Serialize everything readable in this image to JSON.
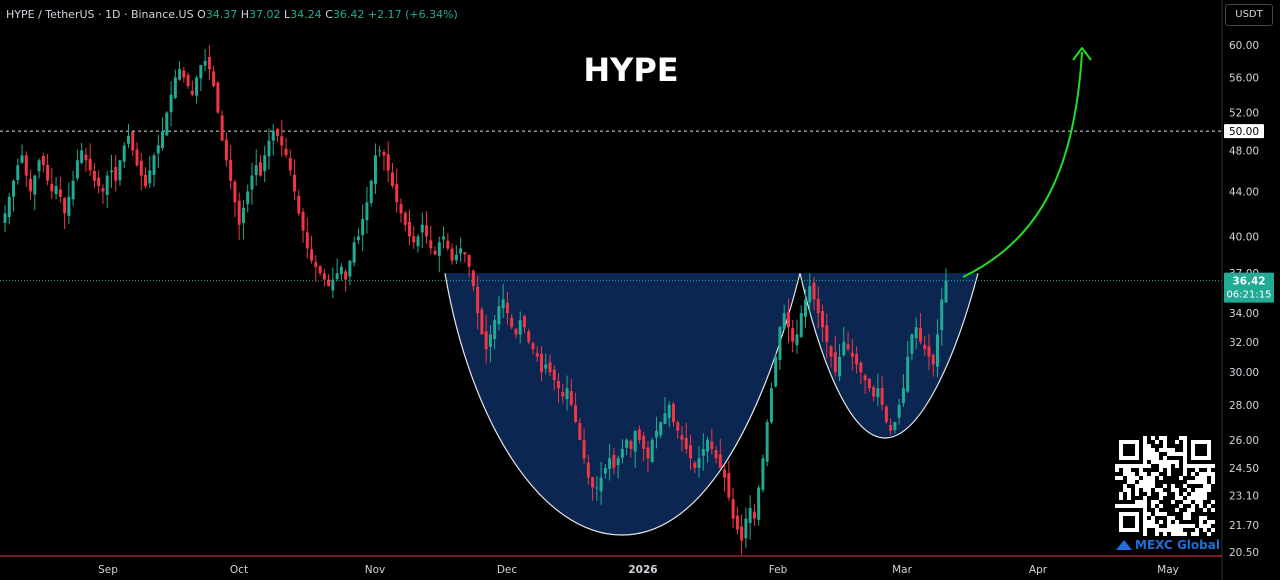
{
  "header": {
    "symbol_line": "HYPE / TetherUS · 1D · Binance.US",
    "o_label": "O",
    "o_value": "34.37",
    "h_label": "H",
    "h_value": "37.02",
    "l_label": "L",
    "l_value": "34.24",
    "c_label": "C",
    "c_value": "36.42",
    "change": "+2.17 (+6.34%)"
  },
  "currency_button": "USDT",
  "watermark_brand": "MEXC Global",
  "colors": {
    "background": "#000000",
    "up": "#22ab94",
    "down": "#f23645",
    "pattern_fill": "#0c2a5a",
    "arrow": "#22dd22",
    "axis_text": "#d1d4dc",
    "price_tag": "#22ab94"
  },
  "chart_data": {
    "type": "candlestick",
    "title": "HYPE",
    "y_ticks": [
      20.5,
      21.7,
      23.1,
      24.5,
      26.0,
      28.0,
      30.0,
      32.0,
      34.0,
      37.0,
      40.0,
      44.0,
      48.0,
      52.0,
      56.0,
      60.0
    ],
    "y_tick_labels": [
      "20.50",
      "21.70",
      "23.10",
      "24.50",
      "26.00",
      "28.00",
      "30.00",
      "32.00",
      "34.00",
      "37.00",
      "40.00",
      "44.00",
      "48.00",
      "52.00",
      "56.00",
      "60.00"
    ],
    "y_scale": "log",
    "ylim": [
      20.2,
      64
    ],
    "x_ticks": [
      "Sep",
      "Oct",
      "Nov",
      "Dec",
      "2026",
      "Feb",
      "Mar",
      "Apr",
      "May"
    ],
    "x_ticks_bold": "2026",
    "reference_line": {
      "value": 50.0,
      "label": "50.00",
      "style": "dashed"
    },
    "last_price": {
      "value": 36.42,
      "label": "36.42",
      "countdown": "06:21:15"
    },
    "pattern": "cup and handle",
    "close_series": [
      42.0,
      43.5,
      45.0,
      46.5,
      47.5,
      45.5,
      44.0,
      45.5,
      47.0,
      46.5,
      45.0,
      44.0,
      44.5,
      43.5,
      42.0,
      43.5,
      45.0,
      47.0,
      48.0,
      47.0,
      46.0,
      45.0,
      44.5,
      44.0,
      45.5,
      46.0,
      45.0,
      47.0,
      48.5,
      49.5,
      48.0,
      46.5,
      45.5,
      44.5,
      46.0,
      47.5,
      48.5,
      50.0,
      52.0,
      54.0,
      56.0,
      57.0,
      56.0,
      55.0,
      54.0,
      56.0,
      57.5,
      58.0,
      57.0,
      55.0,
      52.0,
      49.0,
      47.0,
      45.0,
      43.0,
      41.0,
      42.5,
      44.0,
      45.5,
      46.5,
      45.5,
      47.5,
      49.0,
      50.0,
      49.5,
      48.5,
      47.5,
      46.0,
      44.0,
      42.0,
      40.5,
      39.0,
      38.0,
      37.5,
      37.0,
      36.5,
      36.0,
      36.5,
      37.0,
      37.5,
      36.5,
      38.0,
      39.5,
      40.0,
      41.5,
      43.0,
      45.0,
      47.5,
      48.0,
      47.5,
      46.0,
      44.5,
      43.0,
      42.0,
      41.0,
      40.0,
      39.5,
      40.0,
      41.0,
      40.0,
      39.0,
      38.5,
      39.5,
      40.0,
      39.0,
      38.0,
      38.5,
      39.0,
      38.5,
      37.5,
      36.0,
      34.0,
      32.5,
      31.5,
      32.5,
      33.5,
      34.5,
      35.0,
      34.0,
      33.0,
      32.5,
      33.5,
      33.0,
      32.0,
      31.5,
      31.0,
      30.0,
      30.5,
      30.0,
      29.5,
      29.0,
      28.5,
      29.0,
      28.0,
      27.0,
      26.0,
      25.0,
      24.0,
      23.5,
      23.5,
      24.0,
      24.5,
      25.0,
      24.5,
      25.0,
      25.5,
      26.0,
      25.5,
      26.5,
      26.0,
      25.5,
      25.0,
      26.0,
      26.5,
      27.0,
      27.5,
      28.0,
      27.0,
      26.5,
      26.0,
      25.5,
      25.0,
      24.5,
      25.0,
      25.5,
      26.0,
      25.5,
      25.0,
      24.5,
      24.0,
      23.0,
      22.0,
      21.5,
      21.0,
      22.0,
      22.5,
      22.0,
      23.5,
      25.0,
      27.0,
      29.0,
      31.0,
      33.0,
      34.0,
      33.0,
      32.0,
      32.5,
      34.0,
      35.0,
      36.0,
      35.0,
      34.0,
      33.0,
      32.0,
      31.0,
      30.0,
      31.0,
      32.0,
      31.5,
      31.0,
      30.5,
      30.0,
      29.5,
      29.0,
      28.5,
      29.0,
      28.0,
      27.0,
      26.5,
      27.0,
      28.0,
      29.0,
      31.0,
      32.5,
      33.0,
      32.0,
      31.5,
      31.0,
      30.5,
      32.5,
      35.0,
      36.42
    ]
  }
}
